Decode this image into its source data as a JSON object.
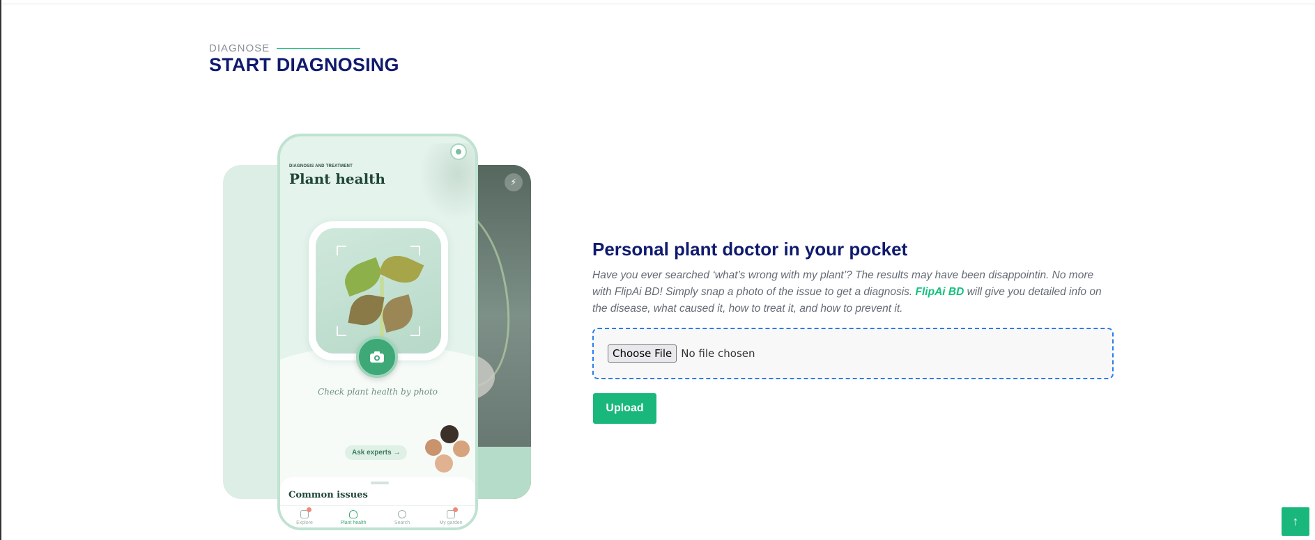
{
  "section": {
    "eyebrow": "DIAGNOSE",
    "title": "START DIAGNOSING"
  },
  "phone": {
    "eyebrow": "DIAGNOSIS AND TREATMENT",
    "title": "Plant health",
    "check_text": "Check plant health by photo",
    "ask_button": "Ask experts →",
    "sheet_title": "Common issues",
    "tabs": [
      {
        "label": "Explore",
        "icon": "explore-icon"
      },
      {
        "label": "Plant health",
        "icon": "heart-pulse-icon",
        "active": true
      },
      {
        "label": "Search",
        "icon": "search-icon"
      },
      {
        "label": "My garden",
        "icon": "garden-icon"
      }
    ]
  },
  "main": {
    "heading": "Personal plant doctor in your pocket",
    "desc_before": "Have you ever searched ‘what’s wrong with my plant’? The results may have been disappointin. No more with FlipAi BD! Simply snap a photo of the issue to get a diagnosis. ",
    "desc_brand": "FlipAi BD",
    "desc_after": " will give you detailed info on the disease, what caused it, how to treat it, and how to prevent it."
  },
  "upload": {
    "choose_label": "Choose File",
    "no_file_text": "No file chosen",
    "button_label": "Upload"
  },
  "scroll_top": {
    "icon": "arrow-up-icon",
    "glyph": "↑"
  },
  "colors": {
    "brand_navy": "#0f1a6e",
    "accent_green": "#1ab77c",
    "dropzone_border": "#2b7de9"
  }
}
